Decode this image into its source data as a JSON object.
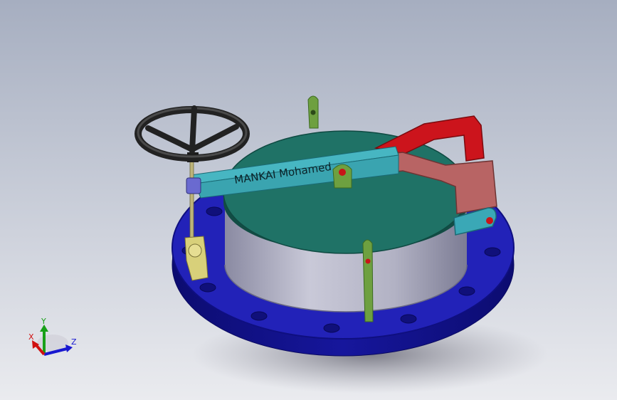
{
  "model": {
    "arm_engraving": "MANKAI Mohamed",
    "colors": {
      "background_top": "#a6aec0",
      "background_bottom": "#eaebef",
      "flange": "#1e1eb0",
      "body": "#b8b8cc",
      "lid": "#1e6e64",
      "arm": "#3fa6b2",
      "red_lever": "#c8141e",
      "pink_bracket": "#b86464",
      "green_lugs": "#6ea040",
      "handwheel": "#2a2a2a",
      "yoke_nut": "#6a6ad0",
      "stem_block": "#d8d07a"
    }
  },
  "axis_triad": {
    "x_label": "X",
    "y_label": "Y",
    "z_label": "Z",
    "x_color": "#d01010",
    "y_color": "#18a018",
    "z_color": "#1818d0"
  }
}
